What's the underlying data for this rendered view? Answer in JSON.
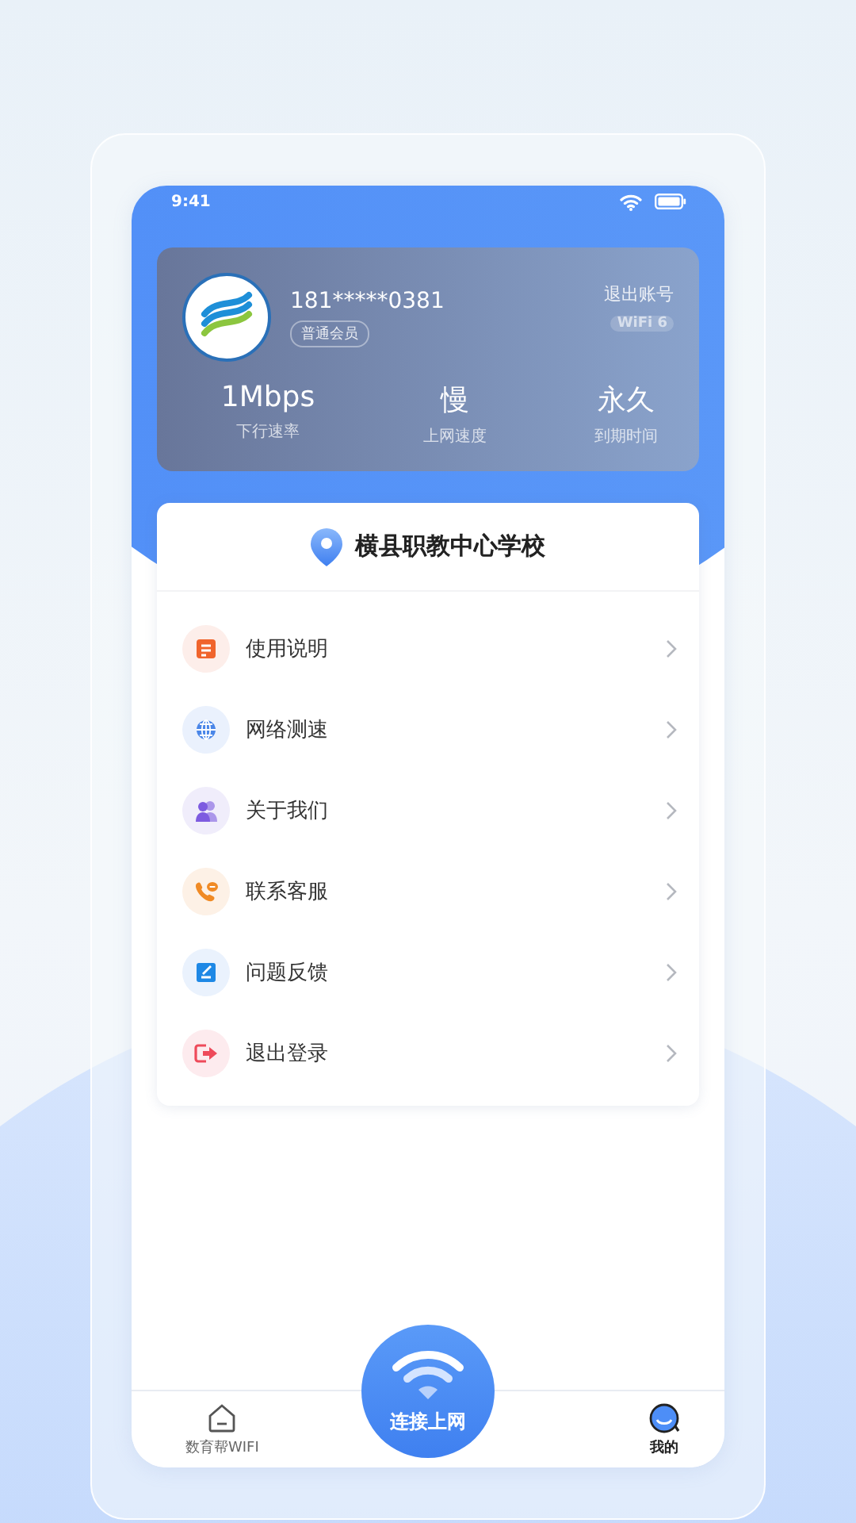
{
  "status_bar": {
    "time": "9:41"
  },
  "account": {
    "phone": "181*****0381",
    "member_tag": "普通会员",
    "logout": "退出账号",
    "wifi_badge": "WiFi 6",
    "stats": [
      {
        "value": "1Mbps",
        "label": "下行速率"
      },
      {
        "value": "慢",
        "label": "上网速度"
      },
      {
        "value": "永久",
        "label": "到期时间"
      }
    ]
  },
  "location": {
    "name": "横县职教中心学校"
  },
  "menu": [
    {
      "kind": "doc",
      "label": "使用说明"
    },
    {
      "kind": "globe",
      "label": "网络测速"
    },
    {
      "kind": "people",
      "label": "关于我们"
    },
    {
      "kind": "phone",
      "label": "联系客服"
    },
    {
      "kind": "edit",
      "label": "问题反馈"
    },
    {
      "kind": "exit",
      "label": "退出登录"
    }
  ],
  "connect_button": {
    "label": "连接上网"
  },
  "tabs": [
    {
      "kind": "home",
      "label": "数育帮WIFI",
      "selected": false
    },
    {
      "kind": "me",
      "label": "我的",
      "selected": true
    }
  ]
}
